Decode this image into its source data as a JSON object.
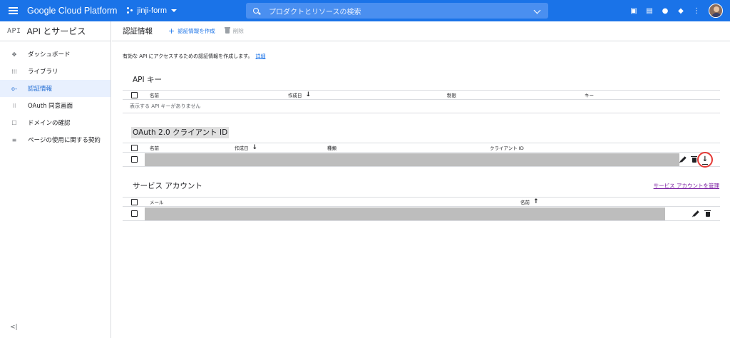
{
  "topbar": {
    "brand": "Google Cloud Platform",
    "project": "jinji-form",
    "search_placeholder": "プロダクトとリソースの検索"
  },
  "sidebar": {
    "logo": "API",
    "title": "API とサービス",
    "items": [
      {
        "label": "ダッシュボード",
        "icon": "dashboard-icon"
      },
      {
        "label": "ライブラリ",
        "icon": "library-icon"
      },
      {
        "label": "認証情報",
        "icon": "key-icon",
        "active": true
      },
      {
        "label": "OAuth 同意画面",
        "icon": "oauth-consent-icon"
      },
      {
        "label": "ドメインの確認",
        "icon": "domain-verification-icon"
      },
      {
        "label": "ページの使用に関する契約",
        "icon": "page-usage-icon"
      }
    ],
    "collapse_label": "<|"
  },
  "header": {
    "title": "認証情報",
    "create_label": "認証情報を作成",
    "delete_label": "削除"
  },
  "intro": {
    "text": "有効な API にアクセスするための認証情報を作成します。",
    "link": "詳細"
  },
  "api_keys": {
    "title": "API キー",
    "columns": [
      "名前",
      "作成日",
      "制限",
      "キー"
    ],
    "empty": "表示する API キーがありません"
  },
  "oauth": {
    "title": "OAuth 2.0 クライアント ID",
    "columns": [
      "名前",
      "作成日",
      "種類",
      "クライアント ID"
    ]
  },
  "service_accounts": {
    "title": "サービス アカウント",
    "manage_link": "サービス アカウントを管理",
    "columns": [
      "メール",
      "名前"
    ]
  },
  "colors": {
    "accent": "#1a73e8",
    "highlight_circle": "#e53935",
    "link_visited": "#7b1fa2"
  }
}
